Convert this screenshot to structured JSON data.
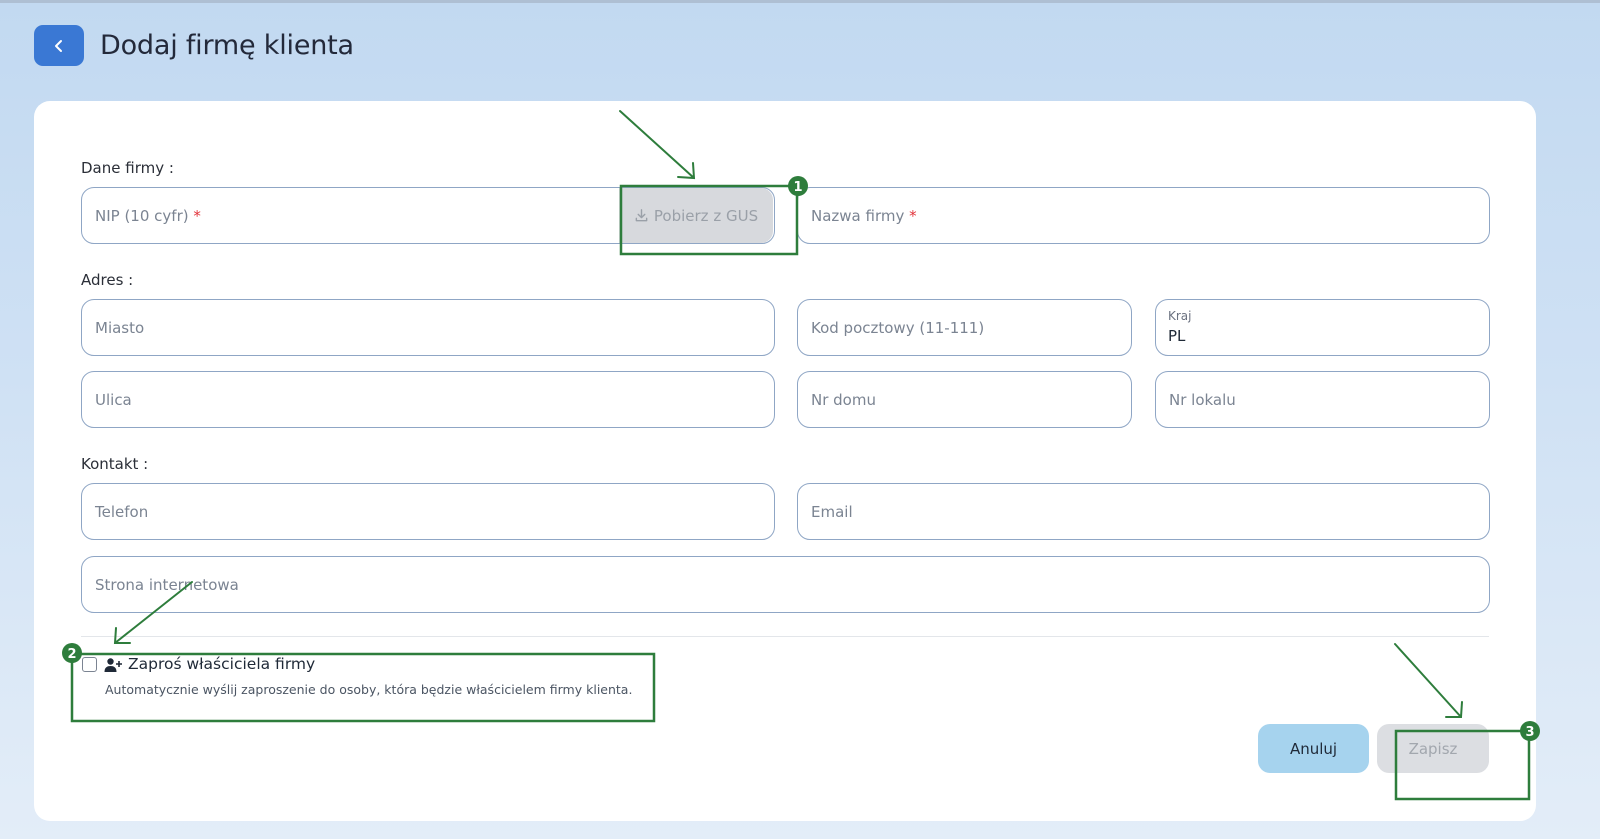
{
  "header": {
    "title": "Dodaj firmę klienta"
  },
  "form": {
    "company_section_label": "Dane firmy :",
    "nip_placeholder": "NIP (10 cyfr)",
    "required_mark": "*",
    "gus_button_label": "Pobierz z GUS",
    "company_name_placeholder": "Nazwa firmy",
    "address_section_label": "Adres :",
    "city_placeholder": "Miasto",
    "postal_code_placeholder": "Kod pocztowy (11-111)",
    "country_label": "Kraj",
    "country_value": "PL",
    "street_placeholder": "Ulica",
    "house_number_placeholder": "Nr domu",
    "apartment_number_placeholder": "Nr lokalu",
    "contact_section_label": "Kontakt :",
    "phone_placeholder": "Telefon",
    "email_placeholder": "Email",
    "website_placeholder": "Strona internetowa",
    "invite_owner_label": "Zaproś właściciela firmy",
    "invite_owner_checked": false,
    "invite_owner_description": "Automatycznie wyślij zaproszenie do osoby, która będzie właścicielem firmy klienta.",
    "cancel_label": "Anuluj",
    "save_label": "Zapisz"
  },
  "annotations": {
    "color": "#2e7d3c",
    "markers": [
      "1",
      "2",
      "3"
    ]
  },
  "colors": {
    "back_button": "#3a78d4",
    "field_border": "#8fa6c5",
    "required": "#e2343b",
    "cancel_button": "#a6d3ee",
    "save_button_disabled": "#dcdee2"
  },
  "icons": {
    "back": "chevron-left-icon",
    "gus": "download-icon",
    "invite": "user-plus-icon"
  }
}
